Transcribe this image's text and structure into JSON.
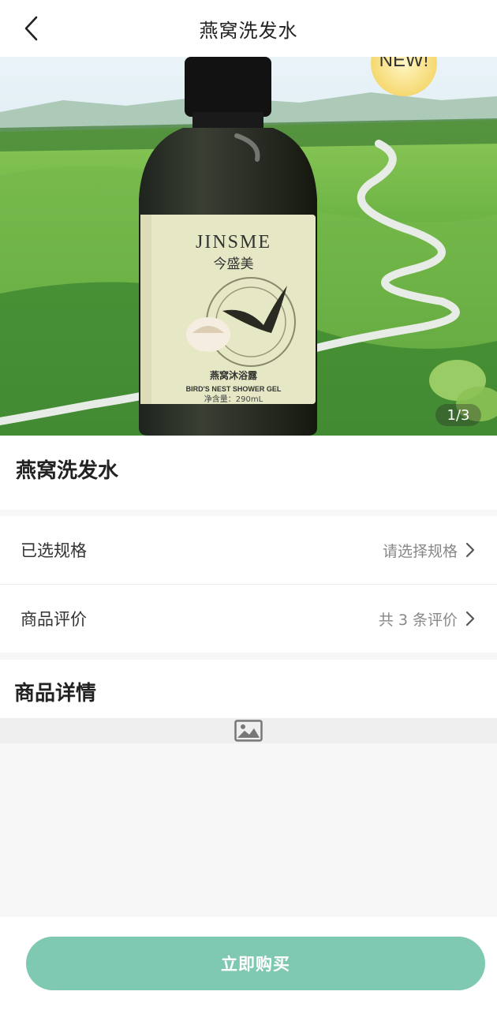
{
  "header": {
    "title": "燕窝洗发水",
    "back_icon": "chevron-left-icon"
  },
  "gallery": {
    "page_indicator": "1/3",
    "current_page": 1,
    "total_pages": 3,
    "product_label": {
      "brand_en": "JINSME",
      "brand_cn": "今盛美",
      "product_cn": "燕窝沐浴露",
      "product_en": "BIRD'S NEST SHOWER GEL",
      "volume": "净含量：290mL"
    },
    "badge_text": "NEW!"
  },
  "product": {
    "title": "燕窝洗发水"
  },
  "spec_row": {
    "label": "已选规格",
    "value": "请选择规格"
  },
  "review_row": {
    "label": "商品评价",
    "value": "共 3 条评价"
  },
  "details": {
    "heading": "商品详情",
    "image_icon": "image-placeholder-icon"
  },
  "actions": {
    "buy_label": "立即购买"
  },
  "colors": {
    "accent": "#7fc8b1",
    "background": "#f7f7f7"
  }
}
